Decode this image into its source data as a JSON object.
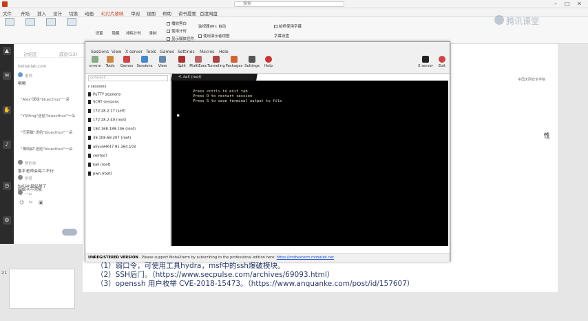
{
  "ppt": {
    "search_text": "搜索",
    "menu": [
      "文件",
      "开始",
      "插入",
      "设计",
      "切换",
      "动画",
      "幻灯片放映",
      "审阅",
      "视图",
      "帮助",
      "讲书提要",
      "百度网盘"
    ],
    "ribbon_buttons": [
      "设置",
      "隐藏",
      "排练计时",
      "录制"
    ],
    "ribbon_checks": [
      "播放旁白",
      "使用计时",
      "显示媒体控件",
      "监视器(M): 自动",
      "使用演示者视图",
      "始终使用字幕",
      "字幕设置"
    ],
    "watermark": "腾讯课堂",
    "slide_number": "21",
    "slide_logo": "中国天网安全学院",
    "slide_side_text": "性",
    "slide_lines": [
      "（1）弱口令，可使用工具hydra，msf中的ssh爆破模块。",
      "（2）SSH后门。（https://www.secpulse.com/archives/69093.html）",
      "（3）openssh 用户枚举 CVE-2018-15473。（https://www.anquanke.com/post/id/157607）"
    ]
  },
  "chat": {
    "tab_discuss": "讨论区",
    "tab_members": "成员(32)",
    "site": "hetianlab.com",
    "teacher_label": "老师",
    "teacher_msg": "哦哦",
    "sys_msgs": [
      "\"Alex\"送给\"bluecthus\"一朵",
      "\"YSMing\"送给\"bluecthus\"一朵",
      "\"任荣敏\"送给\"bluecthus\"一朵",
      "\"薄晓甜\"送给\"bluecthus\"一朵"
    ],
    "user1_name": "梦的你",
    "user1_msg": "鲁平老师会每二不行",
    "user2_name": "学员",
    "user2_msg": "hetian网站掉了",
    "user3_name": "一ω",
    "user3_msg": "网络卡不完帧"
  },
  "moba": {
    "menu": [
      "Sessions",
      "View",
      "X server",
      "Tools",
      "Games",
      "Settings",
      "Macros",
      "Help"
    ],
    "toolbar": [
      "ervers",
      "Tools",
      "Games",
      "Sessions",
      "View",
      "Split",
      "MultiExec",
      "Tunneling",
      "Packages",
      "Settings",
      "Help",
      "X server",
      "Exit"
    ],
    "quick_connect": "connect...",
    "sessions_header": "r sessions",
    "sessions": [
      "PuTTY sessions",
      "SCRT sessions",
      "172.28.2.17 (self)",
      "172.28.2.40 (root)",
      "192.168.189.146 (root)",
      "39.108.68.207 (root)",
      "aliyunHK47.91.164.103",
      "centos7",
      "kali (root)",
      "pwn (root)"
    ],
    "term_tab": "4. kali (root)",
    "term_lines": [
      "                         ",
      "       Press <ctrl> to exit tab",
      "       Press R to restart session",
      "       Press S to save terminal output to file",
      "                              ",
      "■ "
    ],
    "status_bold": "UNREGISTERED VERSION",
    "status_text": " - Please support MobaXterm by subscribing to the professional edition here: ",
    "status_link": "https://mobaxterm.mobatek.net"
  }
}
